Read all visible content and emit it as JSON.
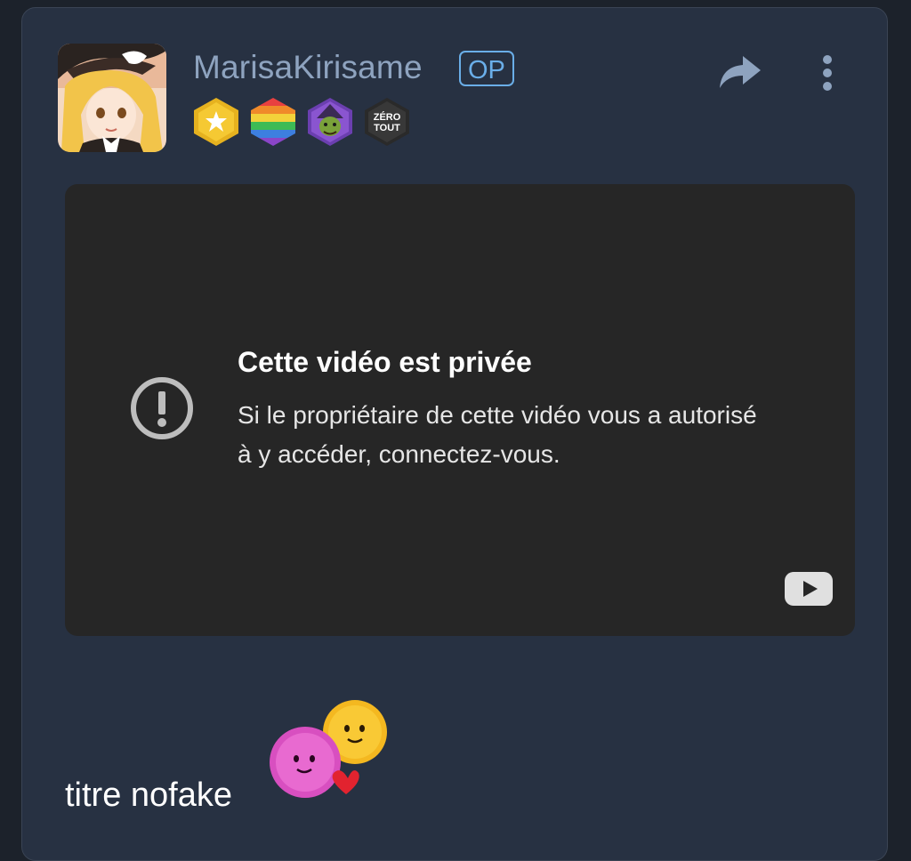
{
  "post": {
    "username": "MarisaKirisame",
    "op_label": "OP",
    "badges": [
      {
        "icon": "star-badge-icon"
      },
      {
        "icon": "rainbow-badge-icon"
      },
      {
        "icon": "wizard-badge-icon"
      },
      {
        "icon": "zero-tout-badge-icon",
        "text_line1": "ZÉRO",
        "text_line2": "TOUT"
      }
    ],
    "title": "titre nofake"
  },
  "video": {
    "title": "Cette vidéo est privée",
    "message": "Si le propriétaire de cette vidéo vous a autorisé à y accéder, connectez-vous."
  },
  "colors": {
    "page_bg": "#1c222b",
    "card_bg": "#273142",
    "username": "#8ea3bf",
    "op_accent": "#6aaee8",
    "video_bg": "#262626"
  }
}
